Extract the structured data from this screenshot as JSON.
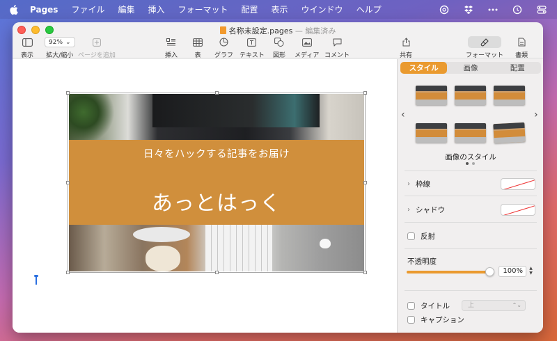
{
  "menubar": {
    "app": "Pages",
    "items": [
      "ファイル",
      "編集",
      "挿入",
      "フォーマット",
      "配置",
      "表示",
      "ウインドウ",
      "ヘルプ"
    ]
  },
  "window": {
    "title": "名称未設定.pages",
    "separator": "—",
    "status": "編集済み"
  },
  "toolbar": {
    "view": "表示",
    "zoom_value": "92%",
    "zoom": "拡大/縮小",
    "add_page": "ページを追加",
    "insert": "挿入",
    "table": "表",
    "chart": "グラフ",
    "text": "テキスト",
    "shape": "図形",
    "media": "メディア",
    "comment": "コメント",
    "share": "共有",
    "format": "フォーマット",
    "document": "書類"
  },
  "canvas": {
    "banner_subtitle": "日々をハックする記事をお届け",
    "banner_title": "あっとはっく"
  },
  "inspector": {
    "tabs": [
      "スタイル",
      "画像",
      "配置"
    ],
    "active_tab": "スタイル",
    "style_caption": "画像のスタイル",
    "border": "枠線",
    "shadow": "シャドウ",
    "reflection": "反射",
    "opacity_label": "不透明度",
    "opacity_value": "100%",
    "opacity": 1.0,
    "title_label": "タイトル",
    "title_position": "上",
    "caption_label": "キャプション",
    "accent_color": "#ea9a2f"
  }
}
